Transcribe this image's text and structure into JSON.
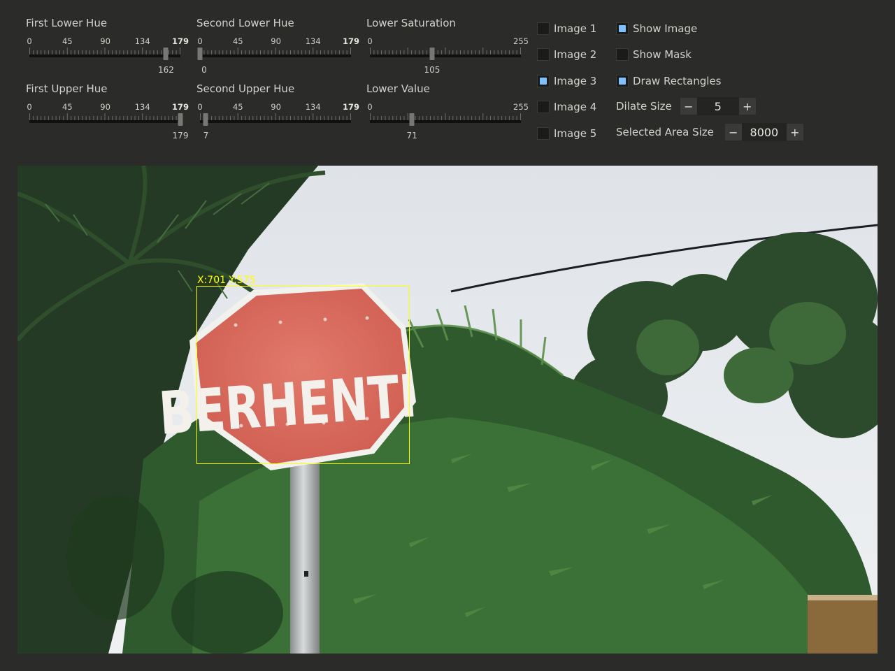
{
  "sliders": [
    {
      "title": "First Lower Hue",
      "ticks": [
        "0",
        "45",
        "90",
        "134",
        "179"
      ],
      "value": "162",
      "pos": 162,
      "max": 179
    },
    {
      "title": "Second Lower Hue",
      "ticks": [
        "0",
        "45",
        "90",
        "134",
        "179"
      ],
      "value": "0",
      "pos": 0,
      "max": 179
    },
    {
      "title": "Lower Saturation",
      "ticks": [
        "0",
        "255"
      ],
      "value": "105",
      "pos": 105,
      "max": 255
    },
    {
      "title": "First Upper Hue",
      "ticks": [
        "0",
        "45",
        "90",
        "134",
        "179"
      ],
      "value": "179",
      "pos": 179,
      "max": 179
    },
    {
      "title": "Second Upper Hue",
      "ticks": [
        "0",
        "45",
        "90",
        "134",
        "179"
      ],
      "value": "7",
      "pos": 7,
      "max": 179
    },
    {
      "title": "Lower Value",
      "ticks": [
        "0",
        "255"
      ],
      "value": "71",
      "pos": 71,
      "max": 255
    }
  ],
  "images": [
    {
      "label": "Image 1",
      "checked": false
    },
    {
      "label": "Image 2",
      "checked": false
    },
    {
      "label": "Image 3",
      "checked": true
    },
    {
      "label": "Image 4",
      "checked": false
    },
    {
      "label": "Image 5",
      "checked": false
    }
  ],
  "options": {
    "show_image": {
      "label": "Show Image",
      "checked": true
    },
    "show_mask": {
      "label": "Show Mask",
      "checked": false
    },
    "draw_rectangles": {
      "label": "Draw Rectangles",
      "checked": true
    }
  },
  "dilate": {
    "label": "Dilate Size",
    "value": "5",
    "minus": "−",
    "plus": "+"
  },
  "area": {
    "label": "Selected Area Size",
    "value": "8000",
    "minus": "−",
    "plus": "+"
  },
  "detection": {
    "label": "X:701 Y:575",
    "sign_text": "BERHENTI",
    "box_color": "#ffff00"
  },
  "colors": {
    "accent": "#7fc1ff",
    "background": "#2b2c2a",
    "sign_red": "#dd6a5c"
  }
}
